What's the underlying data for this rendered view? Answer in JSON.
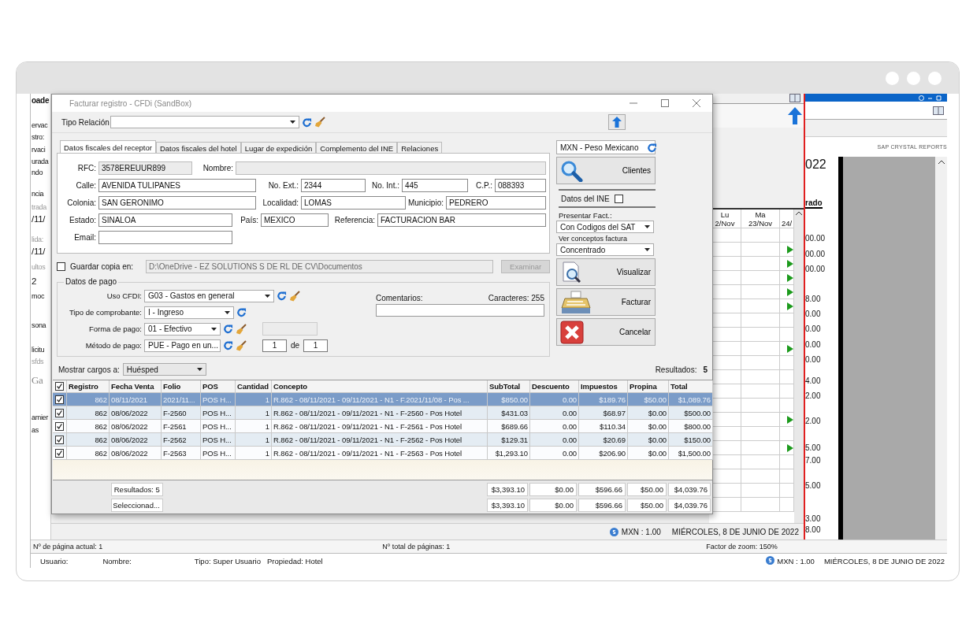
{
  "background": {
    "left_fragments": [
      {
        "text": "oade",
        "kind": "bold"
      },
      {
        "text": "ervac",
        "kind": "plain"
      },
      {
        "text": "stro:",
        "kind": "plain"
      },
      {
        "text": "rvaci",
        "kind": "plain"
      },
      {
        "text": "urada",
        "kind": "plain"
      },
      {
        "text": "ndo",
        "kind": "plain"
      },
      {
        "text": "ncia",
        "kind": "plain"
      },
      {
        "text": "trada",
        "kind": "muted"
      },
      {
        "text": "/11/",
        "kind": "large"
      },
      {
        "text": "lida:",
        "kind": "muted"
      },
      {
        "text": "/11/",
        "kind": "large"
      },
      {
        "text": "ultos",
        "kind": "muted"
      },
      {
        "text": "2",
        "kind": "large"
      },
      {
        "text": "moc",
        "kind": "plain"
      },
      {
        "text": "sona",
        "kind": "plain"
      },
      {
        "text": "licitu",
        "kind": "plain"
      },
      {
        "text": "sfds",
        "kind": "muted"
      },
      {
        "text": "Ga",
        "kind": "serif"
      },
      {
        "text": "amier",
        "kind": "plain"
      },
      {
        "text": "as",
        "kind": "plain"
      }
    ],
    "calendar": {
      "columns": [
        {
          "day": "Lu",
          "date": "2/Nov"
        },
        {
          "day": "Ma",
          "date": "23/Nov"
        },
        {
          "date": "24/"
        }
      ],
      "rows": [
        {
          "marker": false
        },
        {
          "marker": true
        },
        {
          "marker": true
        },
        {
          "marker": true
        },
        {
          "marker": true
        },
        {
          "marker": true
        },
        {
          "marker": false
        },
        {
          "marker": false
        },
        {
          "marker": true
        },
        {
          "marker": false
        },
        {
          "marker": false
        },
        {
          "marker": false
        },
        {
          "marker": false
        },
        {
          "marker": true
        },
        {
          "marker": false
        },
        {
          "marker": true
        },
        {
          "marker": false
        },
        {
          "marker": false
        },
        {
          "marker": false
        },
        {
          "marker": false
        }
      ]
    },
    "report": {
      "brand": "SAP CRYSTAL REPORTS",
      "year_fragment": "022",
      "heading_fragment": "rado",
      "values": [
        "00.00",
        "00.00",
        "00.00",
        "8.00",
        "0.00",
        "0.00",
        "0.00",
        "0.00",
        "4.00",
        "2.00",
        "2.00",
        "5.00",
        "7.00",
        "5.00",
        "3.00",
        "8.00"
      ]
    },
    "app_status": {
      "currency": "MXN : 1.00",
      "date": "MIÉRCOLES, 8 DE JUNIO DE 2022"
    },
    "page_status": [
      "Nº de página actual: 1",
      "Nº total de páginas: 1",
      "Factor de zoom: 150%"
    ],
    "bottom_status": {
      "user": "Usuario:",
      "name": "Nombre:",
      "type": "Tipo: Super Usuario",
      "property": "Propiedad: Hotel",
      "currency": "MXN : 1.00",
      "date": "MIÉRCOLES, 8 DE JUNIO DE 2022"
    }
  },
  "dialog": {
    "title": "Facturar registro - CFDi (SandBox)",
    "tipo_relacion": {
      "label": "Tipo Relación"
    },
    "tabs": [
      {
        "label": "Datos fiscales del receptor",
        "selected": true
      },
      {
        "label": "Datos fiscales del hotel",
        "selected": false
      },
      {
        "label": "Lugar de expedición",
        "selected": false
      },
      {
        "label": "Complemento del INE",
        "selected": false
      },
      {
        "label": "Relaciones",
        "selected": false
      }
    ],
    "receptor_fields": [
      [
        {
          "label": "RFC:",
          "value": "3578EREUUR899",
          "readonly": true
        },
        {
          "label": "Nombre:",
          "readonly": true
        }
      ],
      [
        {
          "label": "Calle:",
          "value": "AVENIDA TULIPANES",
          "readonly": false
        },
        {
          "label": "No. Ext.:",
          "value": "2344",
          "readonly": false
        },
        {
          "label": "No. Int.:",
          "value": "445",
          "readonly": false
        },
        {
          "label": "C.P.:",
          "value": "088393",
          "readonly": false
        }
      ],
      [
        {
          "label": "Colonia:",
          "value": "SAN GERONIMO",
          "readonly": false
        },
        {
          "label": "Localidad:",
          "value": "LOMAS",
          "readonly": false
        },
        {
          "label": "Municipio:",
          "value": "PEDRERO",
          "readonly": false
        }
      ],
      [
        {
          "label": "Estado:",
          "value": "SINALOA",
          "readonly": false
        },
        {
          "label": "País:",
          "value": "MEXICO",
          "readonly": false
        },
        {
          "label": "Referencia:",
          "value": "FACTURACION BAR",
          "readonly": false
        }
      ],
      [
        {
          "label": "Email:",
          "readonly": false
        }
      ]
    ],
    "guardar_copia": {
      "label": "Guardar copia en:",
      "checked": false,
      "path": "D:\\OneDrive - EZ SOLUTIONS S DE RL DE CV\\Documentos",
      "button": "Examinar",
      "button_disabled": true
    },
    "datos_pago": {
      "title": "Datos de pago",
      "fields": [
        {
          "label": "Uso CFDI:",
          "value": "G03 - Gastos en general",
          "clear": true,
          "kind": "plain"
        },
        {
          "label": "Tipo de comprobante:",
          "value": "I - Ingreso",
          "clear": false,
          "kind": "plain"
        },
        {
          "label": "Forma de pago:",
          "value": "01 - Efectivo",
          "clear": true,
          "kind": "extra"
        },
        {
          "label": "Método de pago:",
          "value": "PUE - Pago en un...",
          "clear": true,
          "kind": "pages",
          "from": "1",
          "of_label": "de",
          "to": "1"
        }
      ],
      "comments_label": "Comentarios:",
      "chars": "Caracteres: 255"
    },
    "side": {
      "currency": "MXN - Peso Mexicano",
      "search_button": "Clientes",
      "ine": {
        "label": "Datos del INE",
        "checked": false
      },
      "presentar": {
        "label": "Presentar Fact.:",
        "value": "Con Codigos del SAT"
      },
      "ver": {
        "label": "Ver conceptos factura",
        "value": "Concentrado"
      },
      "actions": [
        {
          "label": "Visualizar",
          "kind": "preview"
        },
        {
          "label": "Facturar",
          "kind": "register"
        },
        {
          "label": "Cancelar",
          "kind": "cancel"
        }
      ]
    },
    "cargos": {
      "label": "Mostrar cargos a:",
      "value": "Huésped",
      "results_label": "Resultados:",
      "results": "5"
    },
    "table": {
      "all_checked": true,
      "columns": [
        "Registro",
        "Fecha Venta",
        "Folio",
        "POS",
        "Cantidad",
        "Concepto",
        "SubTotal",
        "Descuento",
        "Impuestos",
        "Propina",
        "Total"
      ],
      "rows": [
        {
          "checked": true,
          "selected": true,
          "cells": [
            "862",
            "08/11/2021",
            "2021/11...",
            "POS H...",
            "1",
            "R.862 - 08/11/2021 - 09/11/2021 - N1 - F.2021/11/08 - Pos ...",
            "$850.00",
            "0.00",
            "$189.76",
            "$50.00",
            "$1,089.76"
          ]
        },
        {
          "checked": true,
          "selected": false,
          "cells": [
            "862",
            "08/06/2022",
            "F-2560",
            "POS H...",
            "1",
            "R.862 - 08/11/2021 - 09/11/2021 - N1 - F-2560 - Pos Hotel",
            "$431.03",
            "0.00",
            "$68.97",
            "$0.00",
            "$500.00"
          ]
        },
        {
          "checked": true,
          "selected": false,
          "cells": [
            "862",
            "08/06/2022",
            "F-2561",
            "POS H...",
            "1",
            "R.862 - 08/11/2021 - 09/11/2021 - N1 - F-2561 - Pos Hotel",
            "$689.66",
            "0.00",
            "$110.34",
            "$0.00",
            "$800.00"
          ]
        },
        {
          "checked": true,
          "selected": false,
          "cells": [
            "862",
            "08/06/2022",
            "F-2562",
            "POS H...",
            "1",
            "R.862 - 08/11/2021 - 09/11/2021 - N1 - F-2562 - Pos Hotel",
            "$129.31",
            "0.00",
            "$20.69",
            "$0.00",
            "$150.00"
          ]
        },
        {
          "checked": true,
          "selected": false,
          "cells": [
            "862",
            "08/06/2022",
            "F-2563",
            "POS H...",
            "1",
            "R.862 - 08/11/2021 - 09/11/2021 - N1 - F-2563 - Pos Hotel",
            "$1,293.10",
            "0.00",
            "$206.90",
            "$0.00",
            "$1,500.00"
          ]
        }
      ],
      "footer": [
        {
          "label": "Resultados: 5",
          "totals": [
            "$3,393.10",
            "$0.00",
            "$596.66",
            "$50.00",
            "$4,039.76"
          ]
        },
        {
          "label": "Seleccionad...",
          "totals": [
            "$3,393.10",
            "$0.00",
            "$596.66",
            "$50.00",
            "$4,039.76"
          ]
        }
      ]
    }
  }
}
